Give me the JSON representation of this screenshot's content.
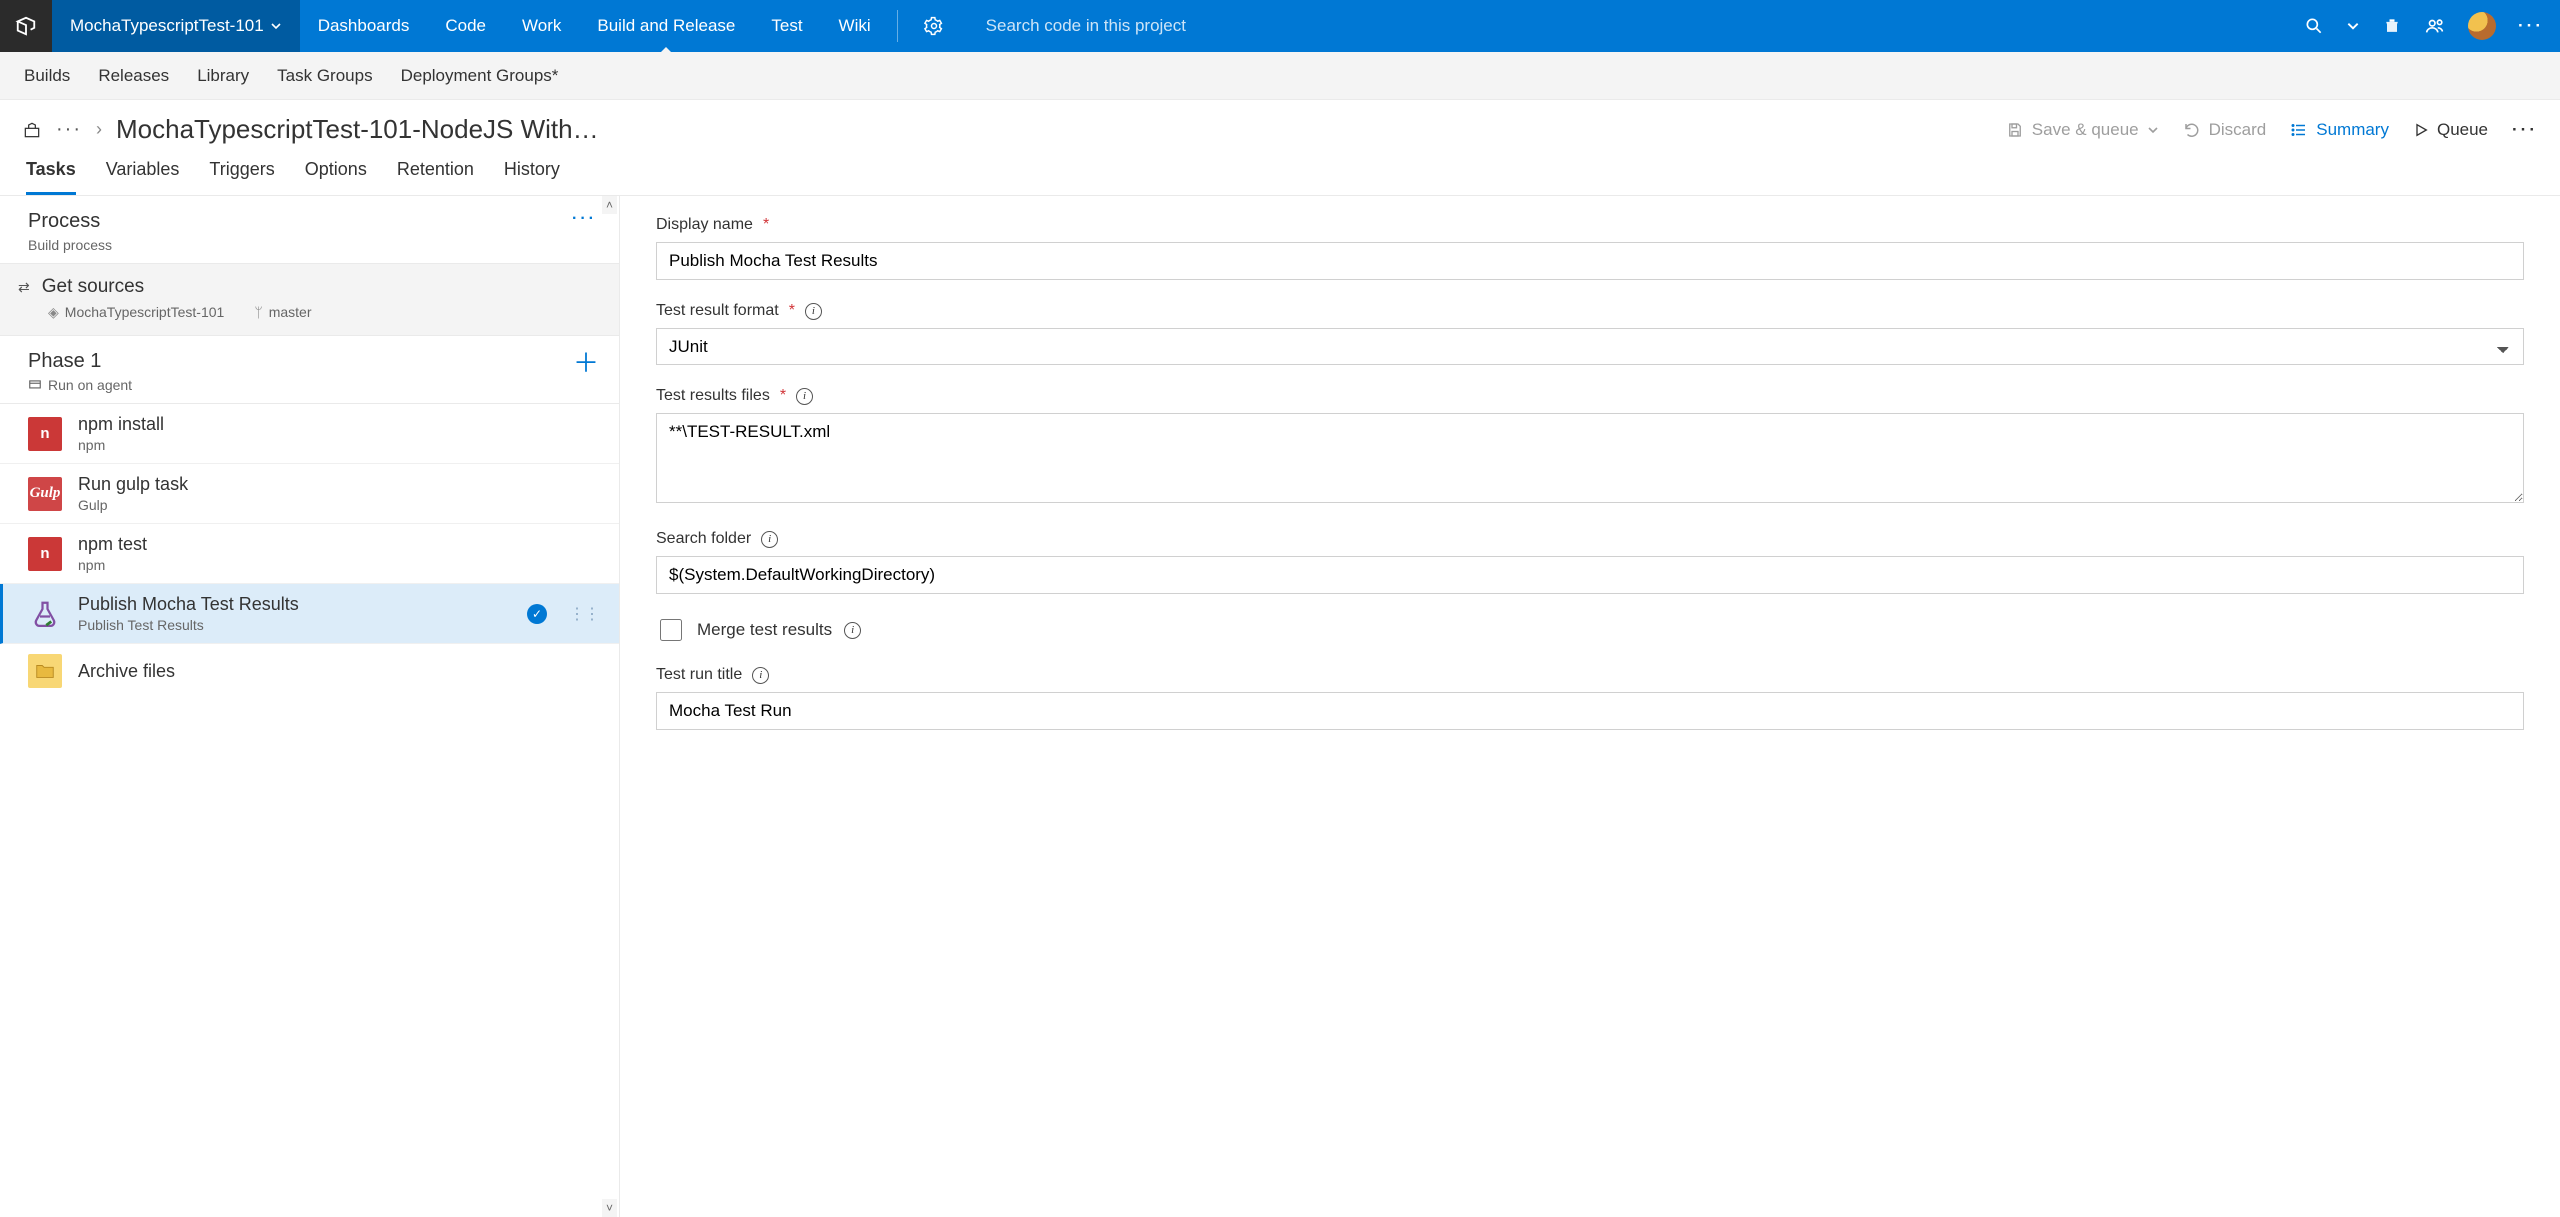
{
  "topbar": {
    "project": "MochaTypescriptTest-101",
    "nav": [
      "Dashboards",
      "Code",
      "Work",
      "Build and Release",
      "Test",
      "Wiki"
    ],
    "activeNav": "Build and Release",
    "searchPlaceholder": "Search code in this project"
  },
  "subnav": [
    "Builds",
    "Releases",
    "Library",
    "Task Groups",
    "Deployment Groups*"
  ],
  "breadcrumb": {
    "title": "MochaTypescriptTest-101-NodeJS With…"
  },
  "toolbar": {
    "saveQueue": "Save & queue",
    "discard": "Discard",
    "summary": "Summary",
    "queue": "Queue"
  },
  "editorTabs": [
    "Tasks",
    "Variables",
    "Triggers",
    "Options",
    "Retention",
    "History"
  ],
  "process": {
    "title": "Process",
    "subtitle": "Build process"
  },
  "sources": {
    "title": "Get sources",
    "repo": "MochaTypescriptTest-101",
    "branch": "master"
  },
  "phase": {
    "title": "Phase 1",
    "subtitle": "Run on agent"
  },
  "tasks": [
    {
      "icon": "npm",
      "title": "npm install",
      "subtitle": "npm"
    },
    {
      "icon": "gulp",
      "title": "Run gulp task",
      "subtitle": "Gulp"
    },
    {
      "icon": "npm",
      "title": "npm test",
      "subtitle": "npm"
    },
    {
      "icon": "flask",
      "title": "Publish Mocha Test Results",
      "subtitle": "Publish Test Results",
      "selected": true
    },
    {
      "icon": "folder",
      "title": "Archive files",
      "subtitle": ""
    }
  ],
  "form": {
    "displayNameLabel": "Display name",
    "displayName": "Publish Mocha Test Results",
    "testFormatLabel": "Test result format",
    "testFormat": "JUnit",
    "testFilesLabel": "Test results files",
    "testFiles": "**\\TEST-RESULT.xml",
    "searchFolderLabel": "Search folder",
    "searchFolder": "$(System.DefaultWorkingDirectory)",
    "mergeLabel": "Merge test results",
    "runTitleLabel": "Test run title",
    "runTitle": "Mocha Test Run"
  }
}
